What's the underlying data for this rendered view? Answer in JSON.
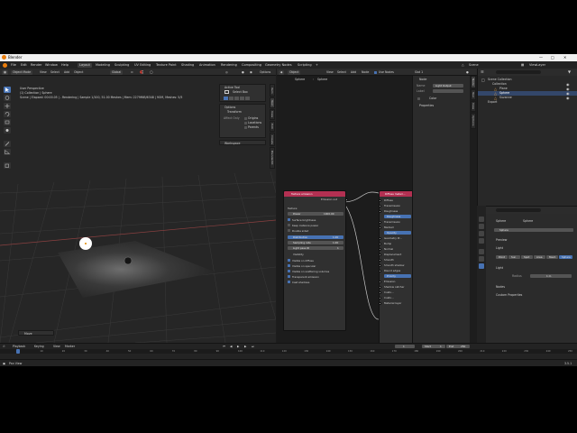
{
  "window": {
    "title": "Blender"
  },
  "menu": {
    "items": [
      "File",
      "Edit",
      "Render",
      "Window",
      "Help"
    ],
    "workspaces": [
      "Layout",
      "Modeling",
      "Sculpting",
      "UV Editing",
      "Texture Paint",
      "Shading",
      "Animation",
      "Rendering",
      "Compositing",
      "Geometry Nodes",
      "Scripting"
    ],
    "active_workspace": "Layout",
    "scene": "Scene",
    "view_layer": "ViewLayer"
  },
  "viewport_header": {
    "mode": "Object Mode",
    "menus": [
      "View",
      "Select",
      "Add",
      "Object"
    ],
    "orientation": "Global",
    "options": "Options"
  },
  "viewport": {
    "perspective": "User Perspective",
    "collection": "(1) Collection | Sphere",
    "render_status": "Scene | Elapsed: 00:00.05 | - Rendering | Sample 1/100, 51.00 Meshes | Mem: 2279MiB/6348 | 9OM, Meshes: 5/5",
    "operator_panel": "Move"
  },
  "tool_settings": {
    "active_tool_title": "Active Tool",
    "active_tool_name": "Select Box",
    "options_title": "Options",
    "transform_label": "Transform",
    "affect_only_label": "Affect Only",
    "checks": [
      "Origins",
      "Locations",
      "Parents"
    ],
    "workspace_label": "Workspace"
  },
  "sidebar_tabs": [
    "Item",
    "Tool",
    "View",
    "Edit",
    "Create",
    "BlenderKit"
  ],
  "node_header": {
    "object_label": "Object",
    "menus": [
      "View",
      "Select",
      "Add",
      "Node"
    ],
    "use_nodes": "Use Nodes",
    "slot": "Slot 1",
    "object_name": "Sphere",
    "breadcrumb": "Sphere"
  },
  "node_emission": {
    "title": "Texture emission",
    "output": "Emission out",
    "texture_label": "Texture:",
    "power_label": "Power",
    "power_value": "1000.00",
    "checks": [
      "Surface brightness",
      "Keep instance power",
      "Double sided"
    ],
    "distribution_label": "Distribution",
    "distribution_value": "1.00",
    "sampling_label": "Sampling rate",
    "sampling_value": "1.00",
    "lightpass_label": "Light pass ID",
    "lightpass_value": "1",
    "visibility_label": "Visibility",
    "vis_checks": [
      "Visible on diffuse",
      "Visible on specular",
      "Visible on scattering volumes",
      "Transparent emission",
      "Cast shadows"
    ]
  },
  "node_diffuse": {
    "title": "Diffuse materi...",
    "inputs": [
      "Diffuse",
      "Transmission",
      "Roughness",
      "Roughness",
      "Transmission",
      "Medium",
      "Opacity",
      "Geometry Pr...",
      "Bump",
      "Normal",
      "Displacement",
      "Smooth",
      "Smooth shadow",
      "Round edges",
      "Priority",
      "Emission",
      "Shadow catcher",
      "Custo...",
      "Custo...",
      "Material layer"
    ],
    "none_label": "None",
    "all_label": "All"
  },
  "node_panel": {
    "title": "Node",
    "name_label": "Name",
    "name_value": "Light Output",
    "label_label": "Label",
    "color_label": "Color",
    "properties_label": "Properties",
    "tabs": [
      "Node",
      "Tool",
      "View",
      "Options"
    ]
  },
  "outliner": {
    "title": "Scene Collection",
    "rows": [
      "Collection",
      "Plane",
      "Sphere",
      "Suzanne",
      "Export"
    ]
  },
  "properties": {
    "breadcrumb_obj": "Sphere",
    "breadcrumb_data": "Sphere",
    "data_name": "Sphere",
    "preview_label": "Preview",
    "light_label": "Light",
    "light_types": [
      "Point",
      "Sun",
      "Spot",
      "Area",
      "Mesh",
      "Sphere"
    ],
    "light_sub": "Light",
    "radius_label": "Radius",
    "radius_value": "1 m",
    "nodes_label": "Nodes",
    "custom_label": "Custom Properties"
  },
  "timeline": {
    "menus": [
      "Playback",
      "Keying",
      "View",
      "Marker"
    ],
    "current_frame": "1",
    "start_label": "Start",
    "start_value": "1",
    "end_label": "End",
    "end_value": "250",
    "ticks": [
      "0",
      "10",
      "20",
      "30",
      "40",
      "50",
      "60",
      "70",
      "80",
      "90",
      "100",
      "110",
      "120",
      "130",
      "140",
      "150",
      "160",
      "170",
      "180",
      "190",
      "200",
      "210",
      "220",
      "230",
      "240",
      "250"
    ]
  },
  "status": {
    "left": "Pan View",
    "version": "3.5.1"
  },
  "colors": {
    "accent": "#4772b3",
    "emission_header": "#b33052",
    "diffuse_header": "#b33052",
    "selected_row": "#33476a"
  }
}
